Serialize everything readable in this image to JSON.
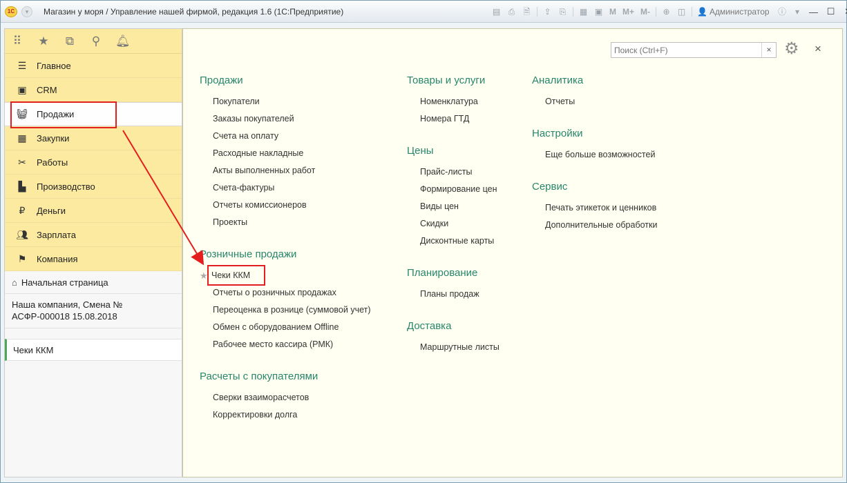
{
  "window": {
    "title": "Магазин у моря / Управление нашей фирмой, редакция 1.6  (1С:Предприятие)",
    "logo_text": "1С",
    "user": "Администратор",
    "toolbar_m": [
      "M",
      "M+",
      "M-"
    ]
  },
  "nav_icons": [
    "apps-icon",
    "star-icon",
    "history-icon",
    "search-icon",
    "bell-icon"
  ],
  "sections": [
    {
      "label": "Главное",
      "icon": "menu-icon"
    },
    {
      "label": "CRM",
      "icon": "contact-card-icon"
    },
    {
      "label": "Продажи",
      "icon": "basket-icon",
      "active": true
    },
    {
      "label": "Закупки",
      "icon": "cart-icon"
    },
    {
      "label": "Работы",
      "icon": "tools-icon"
    },
    {
      "label": "Производство",
      "icon": "factory-icon"
    },
    {
      "label": "Деньги",
      "icon": "ruble-icon"
    },
    {
      "label": "Зарплата",
      "icon": "people-icon"
    },
    {
      "label": "Компания",
      "icon": "flag-icon"
    }
  ],
  "home": {
    "label": "Начальная страница"
  },
  "company": {
    "line1": "Наша компания, Смена №",
    "line2": "АСФР-000018  15.08.2018"
  },
  "open_windows": [
    {
      "label": "Чеки ККМ"
    }
  ],
  "search": {
    "placeholder": "Поиск (Ctrl+F)",
    "clear": "×"
  },
  "close_label": "×",
  "col1": {
    "groups": [
      {
        "title": "Продажи",
        "links": [
          "Покупатели",
          "Заказы покупателей",
          "Счета на оплату",
          "Расходные накладные",
          "Акты выполненных работ",
          "Счета-фактуры",
          "Отчеты комиссионеров",
          "Проекты"
        ]
      },
      {
        "title": "Розничные продажи",
        "links": [
          "Чеки ККМ",
          "Отчеты о розничных продажах",
          "Переоценка в рознице (суммовой учет)",
          "Обмен с оборудованием Offline",
          "Рабочее место кассира (РМК)"
        ]
      },
      {
        "title": "Расчеты с покупателями",
        "links": [
          "Сверки взаиморасчетов",
          "Корректировки долга"
        ]
      }
    ]
  },
  "col2": {
    "groups": [
      {
        "title": "Товары и услуги",
        "links": [
          "Номенклатура",
          "Номера ГТД"
        ]
      },
      {
        "title": "Цены",
        "links": [
          "Прайс-листы",
          "Формирование цен",
          "Виды цен",
          "Скидки",
          "Дисконтные карты"
        ]
      },
      {
        "title": "Планирование",
        "links": [
          "Планы продаж"
        ]
      },
      {
        "title": "Доставка",
        "links": [
          "Маршрутные листы"
        ]
      }
    ]
  },
  "col3": {
    "groups": [
      {
        "title": "Аналитика",
        "links": [
          "Отчеты"
        ]
      },
      {
        "title": "Настройки",
        "links": [
          "Еще больше возможностей"
        ]
      },
      {
        "title": "Сервис",
        "links": [
          "Печать этикеток и ценников",
          "Дополнительные обработки"
        ]
      }
    ]
  },
  "colors": {
    "accent_green": "#27866b",
    "highlight_red": "#e31e1e",
    "panel_yellow": "#fbeaa0",
    "content_bg": "#fffff2"
  }
}
